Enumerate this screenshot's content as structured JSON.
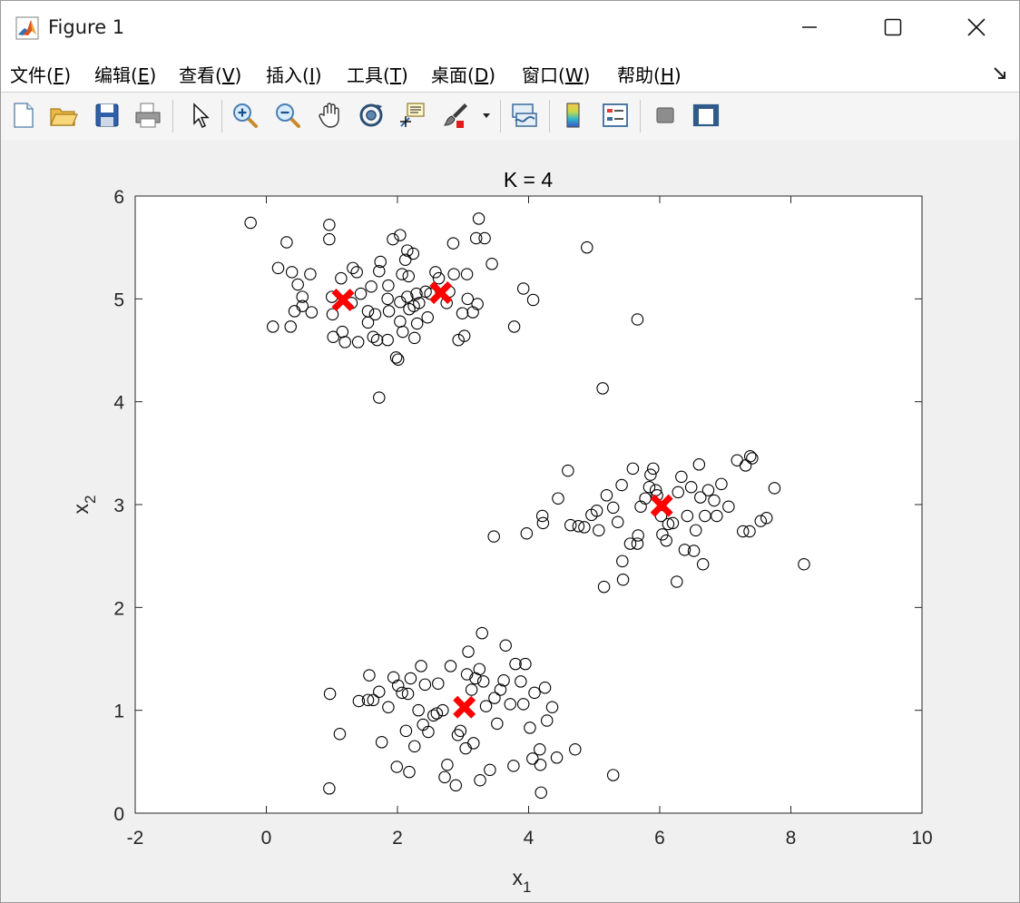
{
  "window": {
    "title": "Figure 1",
    "controls": {
      "minimize": "minimize",
      "maximize": "maximize",
      "close": "close"
    }
  },
  "menu": [
    {
      "label": "文件",
      "key": "F"
    },
    {
      "label": "编辑",
      "key": "E"
    },
    {
      "label": "查看",
      "key": "V"
    },
    {
      "label": "插入",
      "key": "I"
    },
    {
      "label": "工具",
      "key": "T"
    },
    {
      "label": "桌面",
      "key": "D"
    },
    {
      "label": "窗口",
      "key": "W"
    },
    {
      "label": "帮助",
      "key": "H"
    }
  ],
  "toolbar": [
    "new-figure-icon",
    "open-file-icon",
    "save-icon",
    "print-icon",
    "edit-plot-arrow-icon",
    "zoom-in-icon",
    "zoom-out-icon",
    "pan-hand-icon",
    "rotate-3d-icon",
    "data-cursor-icon",
    "brush-icon",
    "brush-dropdown-icon",
    "link-plot-icon",
    "colorbar-icon",
    "legend-icon",
    "hide-plot-tools-icon",
    "show-plot-tools-icon"
  ],
  "colors": {
    "points": "#000000",
    "centroids": "#ff0000",
    "axes_background": "#ffffff",
    "figure_background": "#f0f0f0"
  },
  "chart_data": {
    "type": "scatter",
    "title": "K = 4",
    "xlabel": "x",
    "xlabel_subscript": "1",
    "ylabel": "x",
    "ylabel_subscript": "2",
    "xlim": [
      -2,
      10
    ],
    "ylim": [
      0,
      6
    ],
    "xticks": [
      "-2",
      "0",
      "2",
      "4",
      "6",
      "8",
      "10"
    ],
    "yticks": [
      "0",
      "1",
      "2",
      "3",
      "4",
      "5",
      "6"
    ],
    "grid": false,
    "point_marker": "open-circle",
    "centroid_marker": "x",
    "centroids": [
      [
        1.17,
        4.99
      ],
      [
        2.66,
        5.06
      ],
      [
        6.03,
        2.99
      ],
      [
        3.02,
        1.03
      ]
    ],
    "points": [
      [
        -0.24,
        5.74
      ],
      [
        0.1,
        4.73
      ],
      [
        0.18,
        5.3
      ],
      [
        0.31,
        5.55
      ],
      [
        0.37,
        4.73
      ],
      [
        0.39,
        5.26
      ],
      [
        0.43,
        4.88
      ],
      [
        0.48,
        5.14
      ],
      [
        0.55,
        4.93
      ],
      [
        0.55,
        5.02
      ],
      [
        0.67,
        5.24
      ],
      [
        0.69,
        4.87
      ],
      [
        0.96,
        5.72
      ],
      [
        0.96,
        5.58
      ],
      [
        1.0,
        5.02
      ],
      [
        1.01,
        4.85
      ],
      [
        1.02,
        4.63
      ],
      [
        1.14,
        5.2
      ],
      [
        1.16,
        4.68
      ],
      [
        1.2,
        4.58
      ],
      [
        1.3,
        4.96
      ],
      [
        1.32,
        5.3
      ],
      [
        1.38,
        5.26
      ],
      [
        1.4,
        4.58
      ],
      [
        1.44,
        5.05
      ],
      [
        1.55,
        4.77
      ],
      [
        1.55,
        4.88
      ],
      [
        1.6,
        5.12
      ],
      [
        1.63,
        4.63
      ],
      [
        1.66,
        4.85
      ],
      [
        1.69,
        4.6
      ],
      [
        1.72,
        5.27
      ],
      [
        1.74,
        5.36
      ],
      [
        1.72,
        4.04
      ],
      [
        1.85,
        4.6
      ],
      [
        1.85,
        5.0
      ],
      [
        1.86,
        5.13
      ],
      [
        1.87,
        4.88
      ],
      [
        1.93,
        5.58
      ],
      [
        1.98,
        4.43
      ],
      [
        2.01,
        4.41
      ],
      [
        2.04,
        5.62
      ],
      [
        2.04,
        4.78
      ],
      [
        2.04,
        4.97
      ],
      [
        2.07,
        5.24
      ],
      [
        2.08,
        4.68
      ],
      [
        2.12,
        5.38
      ],
      [
        2.15,
        5.47
      ],
      [
        2.15,
        5.02
      ],
      [
        2.17,
        5.22
      ],
      [
        2.18,
        4.9
      ],
      [
        2.24,
        5.44
      ],
      [
        2.25,
        4.93
      ],
      [
        2.26,
        4.62
      ],
      [
        2.29,
        5.05
      ],
      [
        2.3,
        4.76
      ],
      [
        2.33,
        4.96
      ],
      [
        2.43,
        5.07
      ],
      [
        2.46,
        4.82
      ],
      [
        2.5,
        5.05
      ],
      [
        2.58,
        5.26
      ],
      [
        2.63,
        5.2
      ],
      [
        2.75,
        4.96
      ],
      [
        2.79,
        5.07
      ],
      [
        2.85,
        5.54
      ],
      [
        2.86,
        5.24
      ],
      [
        2.93,
        4.6
      ],
      [
        2.99,
        4.86
      ],
      [
        3.02,
        4.64
      ],
      [
        3.06,
        5.24
      ],
      [
        3.07,
        5.0
      ],
      [
        3.15,
        4.87
      ],
      [
        3.2,
        5.59
      ],
      [
        3.22,
        4.95
      ],
      [
        3.24,
        5.78
      ],
      [
        3.33,
        5.59
      ],
      [
        3.44,
        5.34
      ],
      [
        3.78,
        4.73
      ],
      [
        3.92,
        5.1
      ],
      [
        4.07,
        4.99
      ],
      [
        4.89,
        5.5
      ],
      [
        5.13,
        4.13
      ],
      [
        5.66,
        4.8
      ],
      [
        3.47,
        2.69
      ],
      [
        3.97,
        2.72
      ],
      [
        4.21,
        2.89
      ],
      [
        4.22,
        2.82
      ],
      [
        4.45,
        3.06
      ],
      [
        4.6,
        3.33
      ],
      [
        4.64,
        2.8
      ],
      [
        4.76,
        2.79
      ],
      [
        4.85,
        2.78
      ],
      [
        4.96,
        2.9
      ],
      [
        5.04,
        2.94
      ],
      [
        5.07,
        2.75
      ],
      [
        5.15,
        2.2
      ],
      [
        5.19,
        3.09
      ],
      [
        5.29,
        2.97
      ],
      [
        5.36,
        2.83
      ],
      [
        5.42,
        3.19
      ],
      [
        5.43,
        2.45
      ],
      [
        5.44,
        2.27
      ],
      [
        5.55,
        2.62
      ],
      [
        5.59,
        3.35
      ],
      [
        5.66,
        2.62
      ],
      [
        5.67,
        2.7
      ],
      [
        5.71,
        2.98
      ],
      [
        5.78,
        3.06
      ],
      [
        5.84,
        3.17
      ],
      [
        5.86,
        3.29
      ],
      [
        5.9,
        3.35
      ],
      [
        5.94,
        3.14
      ],
      [
        5.96,
        3.09
      ],
      [
        6.02,
        2.89
      ],
      [
        6.04,
        2.71
      ],
      [
        6.1,
        2.65
      ],
      [
        6.13,
        2.81
      ],
      [
        6.2,
        2.82
      ],
      [
        6.26,
        2.25
      ],
      [
        6.28,
        3.12
      ],
      [
        6.33,
        3.27
      ],
      [
        6.38,
        2.56
      ],
      [
        6.42,
        2.89
      ],
      [
        6.48,
        3.17
      ],
      [
        6.52,
        2.55
      ],
      [
        6.55,
        2.75
      ],
      [
        6.6,
        3.39
      ],
      [
        6.62,
        3.07
      ],
      [
        6.66,
        2.42
      ],
      [
        6.69,
        2.89
      ],
      [
        6.74,
        3.14
      ],
      [
        6.83,
        3.04
      ],
      [
        6.87,
        2.89
      ],
      [
        6.94,
        3.2
      ],
      [
        7.05,
        2.98
      ],
      [
        7.18,
        3.43
      ],
      [
        7.27,
        2.74
      ],
      [
        7.31,
        3.38
      ],
      [
        7.37,
        2.74
      ],
      [
        7.38,
        3.47
      ],
      [
        7.41,
        3.45
      ],
      [
        7.54,
        2.84
      ],
      [
        7.63,
        2.87
      ],
      [
        7.75,
        3.16
      ],
      [
        8.2,
        2.42
      ],
      [
        0.96,
        0.24
      ],
      [
        0.97,
        1.16
      ],
      [
        1.12,
        0.77
      ],
      [
        1.41,
        1.09
      ],
      [
        1.55,
        1.1
      ],
      [
        1.57,
        1.34
      ],
      [
        1.63,
        1.1
      ],
      [
        1.72,
        1.18
      ],
      [
        1.76,
        0.69
      ],
      [
        1.86,
        1.03
      ],
      [
        1.94,
        1.32
      ],
      [
        1.99,
        0.45
      ],
      [
        2.01,
        1.24
      ],
      [
        2.07,
        1.17
      ],
      [
        2.13,
        0.8
      ],
      [
        2.16,
        1.16
      ],
      [
        2.18,
        0.4
      ],
      [
        2.2,
        1.31
      ],
      [
        2.26,
        0.65
      ],
      [
        2.32,
        1.0
      ],
      [
        2.36,
        1.43
      ],
      [
        2.39,
        0.86
      ],
      [
        2.42,
        1.25
      ],
      [
        2.47,
        0.79
      ],
      [
        2.55,
        0.95
      ],
      [
        2.6,
        0.97
      ],
      [
        2.62,
        1.26
      ],
      [
        2.69,
        1.0
      ],
      [
        2.72,
        0.35
      ],
      [
        2.76,
        0.47
      ],
      [
        2.81,
        1.43
      ],
      [
        2.89,
        0.27
      ],
      [
        2.92,
        0.76
      ],
      [
        2.96,
        0.8
      ],
      [
        3.04,
        0.63
      ],
      [
        3.06,
        1.35
      ],
      [
        3.08,
        1.57
      ],
      [
        3.13,
        1.2
      ],
      [
        3.16,
        0.68
      ],
      [
        3.19,
        1.31
      ],
      [
        3.25,
        1.4
      ],
      [
        3.26,
        0.32
      ],
      [
        3.29,
        1.75
      ],
      [
        3.31,
        1.28
      ],
      [
        3.35,
        1.04
      ],
      [
        3.41,
        0.42
      ],
      [
        3.48,
        1.12
      ],
      [
        3.52,
        0.87
      ],
      [
        3.57,
        1.2
      ],
      [
        3.62,
        1.29
      ],
      [
        3.65,
        1.63
      ],
      [
        3.72,
        1.06
      ],
      [
        3.77,
        0.46
      ],
      [
        3.8,
        1.45
      ],
      [
        3.88,
        1.28
      ],
      [
        3.92,
        1.06
      ],
      [
        3.95,
        1.45
      ],
      [
        4.02,
        0.83
      ],
      [
        4.06,
        0.53
      ],
      [
        4.09,
        1.17
      ],
      [
        4.17,
        0.62
      ],
      [
        4.18,
        0.47
      ],
      [
        4.19,
        0.2
      ],
      [
        4.25,
        1.22
      ],
      [
        4.28,
        0.9
      ],
      [
        4.36,
        1.03
      ],
      [
        4.43,
        0.54
      ],
      [
        4.71,
        0.62
      ],
      [
        5.29,
        0.37
      ]
    ]
  }
}
